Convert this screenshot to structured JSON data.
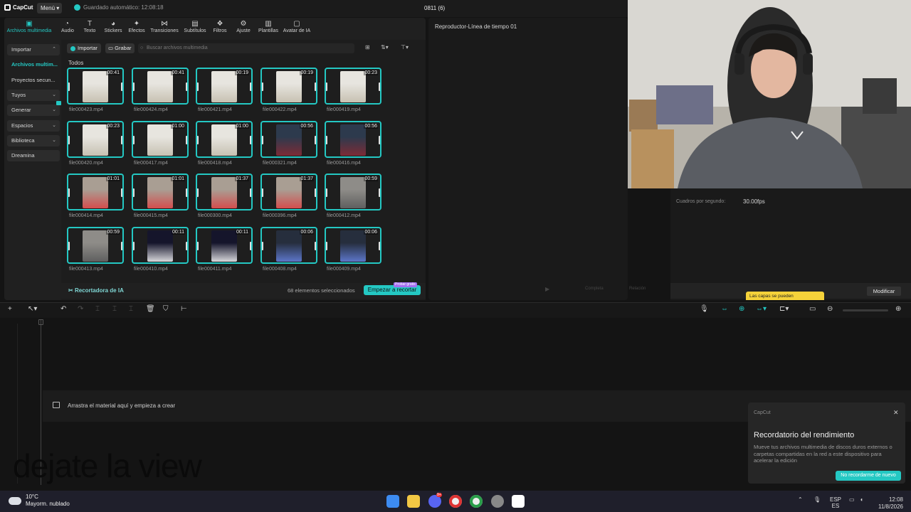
{
  "titlebar": {
    "app": "CapCut",
    "menu": "Menú",
    "saved": "Guardado automático: 12:08:18",
    "project": "0811 (6)"
  },
  "toolbar": [
    {
      "label": "Archivos multimedia",
      "icon": "media-icon",
      "active": true
    },
    {
      "label": "Audio",
      "icon": "audio-icon"
    },
    {
      "label": "Texto",
      "icon": "text-icon"
    },
    {
      "label": "Stickers",
      "icon": "stickers-icon"
    },
    {
      "label": "Efectos",
      "icon": "effects-icon"
    },
    {
      "label": "Transiciones",
      "icon": "transitions-icon"
    },
    {
      "label": "Subtítulos",
      "icon": "subtitles-icon"
    },
    {
      "label": "Filtros",
      "icon": "filters-icon"
    },
    {
      "label": "Ajuste",
      "icon": "adjust-icon"
    },
    {
      "label": "Plantillas",
      "icon": "templates-icon"
    },
    {
      "label": "Avatar de IA",
      "icon": "avatar-icon"
    }
  ],
  "sidenav": [
    {
      "label": "Importar",
      "chevron": "^"
    },
    {
      "label": "Archivos multim..."
    },
    {
      "label": "Proyectos secun..."
    },
    {
      "label": "Tuyos",
      "chevron": "v"
    },
    {
      "label": "Generar",
      "chevron": "v"
    },
    {
      "label": "Espacios",
      "chevron": "v"
    },
    {
      "label": "Biblioteca",
      "chevron": "v"
    },
    {
      "label": "Dreamina"
    }
  ],
  "media": {
    "import": "Importar",
    "record": "Grabar",
    "search_placeholder": "Buscar archivos multimedia",
    "section": "Todos",
    "items": [
      {
        "file": "file000423.mp4",
        "dur": "00:41",
        "tone": "lab"
      },
      {
        "file": "file000424.mp4",
        "dur": "00:41",
        "tone": "lab"
      },
      {
        "file": "file000421.mp4",
        "dur": "00:19",
        "tone": "lab"
      },
      {
        "file": "file000422.mp4",
        "dur": "00:19",
        "tone": "lab"
      },
      {
        "file": "file000419.mp4",
        "dur": "00:23",
        "tone": "lab"
      },
      {
        "file": "file000420.mp4",
        "dur": "00:23",
        "tone": "lab"
      },
      {
        "file": "file000417.mp4",
        "dur": "01:00",
        "tone": "lab"
      },
      {
        "file": "file000418.mp4",
        "dur": "01:00",
        "tone": "lab"
      },
      {
        "file": "file000321.mp4",
        "dur": "00:56",
        "tone": "store"
      },
      {
        "file": "file000416.mp4",
        "dur": "00:56",
        "tone": "store"
      },
      {
        "file": "file000414.mp4",
        "dur": "01:01",
        "tone": "shop"
      },
      {
        "file": "file000415.mp4",
        "dur": "01:01",
        "tone": "shop"
      },
      {
        "file": "file000300.mp4",
        "dur": "01:37",
        "tone": "shop"
      },
      {
        "file": "file000396.mp4",
        "dur": "01:37",
        "tone": "shop"
      },
      {
        "file": "file000412.mp4",
        "dur": "00:59",
        "tone": "grey"
      },
      {
        "file": "file000413.mp4",
        "dur": "00:59",
        "tone": "grey"
      },
      {
        "file": "file000410.mp4",
        "dur": "00:11",
        "tone": "box"
      },
      {
        "file": "file000411.mp4",
        "dur": "00:11",
        "tone": "box"
      },
      {
        "file": "file000408.mp4",
        "dur": "00:06",
        "tone": "pc"
      },
      {
        "file": "file000409.mp4",
        "dur": "00:06",
        "tone": "pc"
      }
    ],
    "footer_label": "Recortadora de IA",
    "selected": "68 elementos seleccionados",
    "cut_button": "Empezar a recortar",
    "trial_badge": "Probar gratis"
  },
  "player": {
    "title": "Reproductor-Línea de tiempo 01",
    "ratio": "Completa",
    "proportion": "Relación"
  },
  "details": {
    "fps_label": "Cuadros por segundo:",
    "fps_value": "30.00fps",
    "modify": "Modificar",
    "toast": "Las capas se pueden"
  },
  "timeline": {
    "drop_hint": "Arrastra el material aquí y empieza a crear"
  },
  "overlay_caption": "dejate la view",
  "popup": {
    "app": "CapCut",
    "title": "Recordatorio del rendimiento",
    "body": "Mueve tus archivos multimedia de discos duros externos o carpetas compartidas en la red a este dispositivo para acelerar la edición",
    "button": "No recordarme de nuevo"
  },
  "taskbar": {
    "temp": "10°C",
    "weather": "Mayorm. nublado",
    "lang1": "ESP",
    "lang2": "ES",
    "time": "12:08",
    "date": "11/8/2026",
    "badge": "9+"
  },
  "colors": {
    "accent": "#24c8c3",
    "trial": "#a46ef0",
    "toast": "#f5d23a"
  }
}
